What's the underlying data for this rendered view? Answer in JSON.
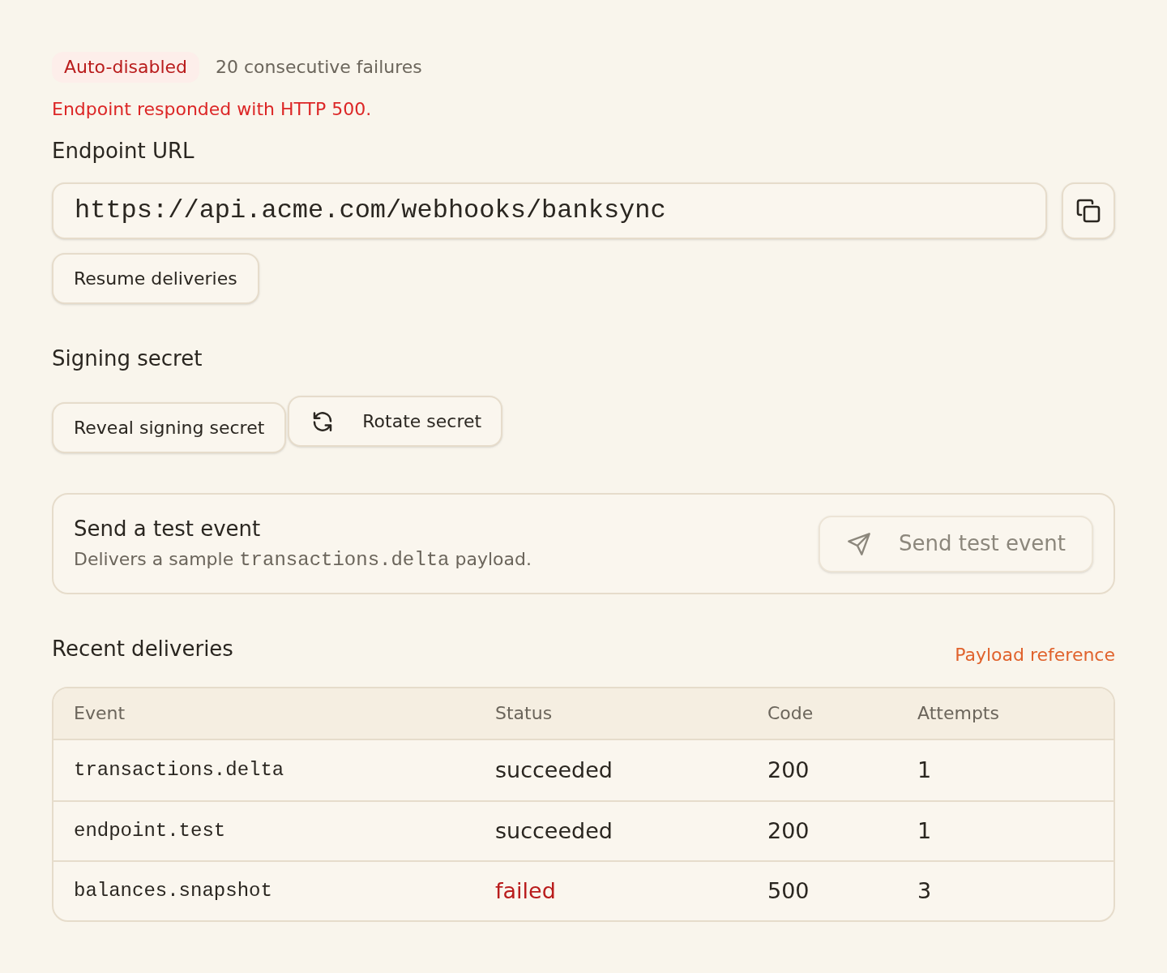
{
  "status": {
    "badge": "Auto-disabled",
    "failures": "20 consecutive failures",
    "error": "Endpoint responded with HTTP 500."
  },
  "endpoint": {
    "label": "Endpoint URL",
    "url": "https://api.acme.com/webhooks/banksync",
    "resume_button": "Resume deliveries"
  },
  "signing_secret": {
    "heading": "Signing secret",
    "reveal_button": "Reveal signing secret",
    "rotate_button": "Rotate secret"
  },
  "test_event": {
    "title": "Send a test event",
    "description": {
      "before": "Delivers a sample",
      "code": "transactions.delta",
      "after": "payload."
    },
    "button": {
      "label": "Send test event",
      "disabled": true
    }
  },
  "deliveries": {
    "heading": "Recent deliveries",
    "link": "Payload reference",
    "table": {
      "columns": [
        "Event",
        "Status",
        "Code",
        "Attempts"
      ],
      "rows": [
        {
          "event": "transactions.delta",
          "status": "succeeded",
          "kind": "success",
          "code": "200",
          "attempts": "1"
        },
        {
          "event": "endpoint.test",
          "status": "succeeded",
          "kind": "success",
          "code": "200",
          "attempts": "1"
        },
        {
          "event": "balances.snapshot",
          "status": "failed",
          "kind": "failure",
          "code": "500",
          "attempts": "3"
        }
      ]
    }
  }
}
